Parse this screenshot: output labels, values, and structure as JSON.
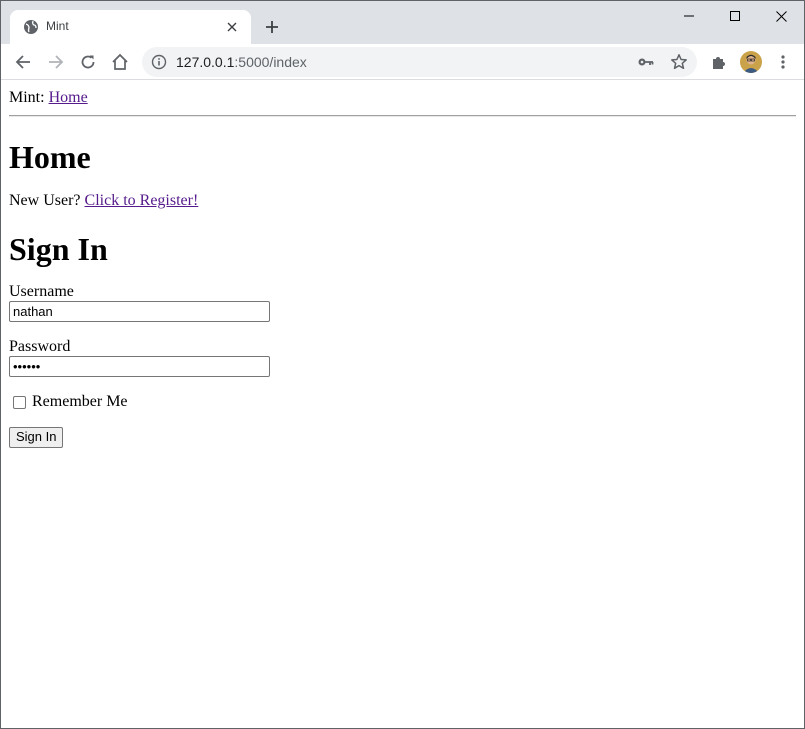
{
  "browser": {
    "tab_title": "Mint",
    "url_host": "127.0.0.1",
    "url_path": ":5000/index"
  },
  "page": {
    "nav_prefix": "Mint: ",
    "nav_home_link": "Home",
    "heading": "Home",
    "register_prompt": "New User? ",
    "register_link": "Click to Register!",
    "signin_heading": "Sign In",
    "username_label": "Username",
    "username_value": "nathan",
    "password_label": "Password",
    "password_value": "••••••",
    "remember_label": "Remember Me",
    "remember_checked": false,
    "submit_label": "Sign In"
  },
  "icons": {
    "favicon": "globe-icon",
    "tab_close": "close-icon",
    "new_tab": "plus-icon",
    "back": "arrow-left-icon",
    "forward": "arrow-right-icon",
    "reload": "reload-icon",
    "home": "home-icon",
    "site_info": "info-icon",
    "password_key": "key-icon",
    "bookmark": "star-icon",
    "extensions": "puzzle-icon",
    "profile": "avatar",
    "menu": "kebab-menu-icon"
  }
}
